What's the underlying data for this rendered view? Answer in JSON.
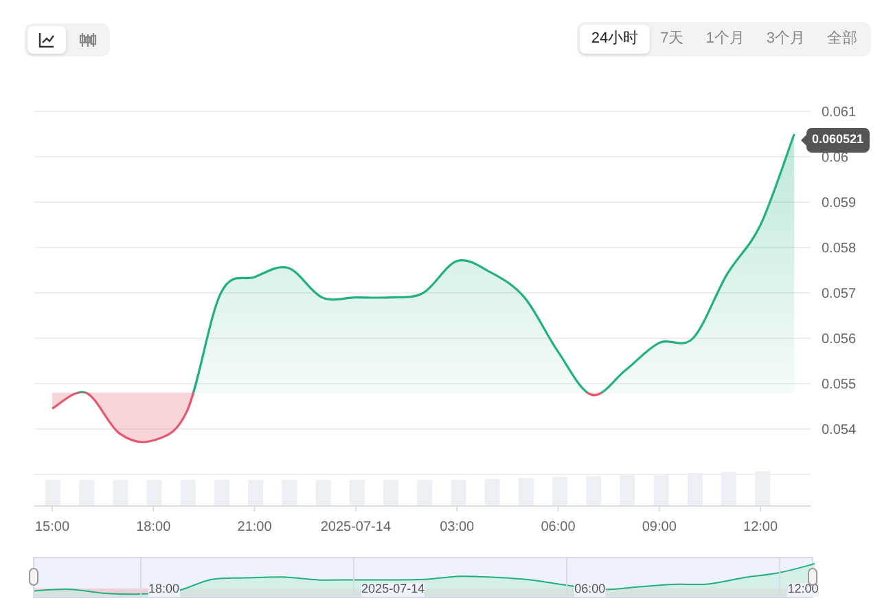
{
  "chart_type_toggle": [
    {
      "kind": "line",
      "selected": true
    },
    {
      "kind": "candles",
      "selected": false
    }
  ],
  "ranges": [
    {
      "label": "24小时",
      "selected": true
    },
    {
      "label": "7天",
      "selected": false
    },
    {
      "label": "1个月",
      "selected": false
    },
    {
      "label": "3个月",
      "selected": false
    },
    {
      "label": "全部",
      "selected": false
    }
  ],
  "price_chart": {
    "chart_data": {
      "type": "area",
      "categories": [
        "15:00",
        null,
        null,
        "18:00",
        null,
        null,
        "21:00",
        null,
        null,
        "2025-07-14",
        null,
        null,
        "03:00",
        null,
        null,
        "06:00",
        null,
        null,
        "09:00",
        null,
        null,
        "12:00",
        null
      ],
      "series": [
        {
          "color": "#22b07d",
          "values": [
            0.05445,
            0.0548,
            0.0539,
            0.05375,
            0.0544,
            0.057,
            0.05735,
            0.05755,
            0.0569,
            0.0569,
            0.0569,
            0.057,
            0.0577,
            0.05745,
            0.0569,
            0.0557,
            0.05475,
            0.0553,
            0.0559,
            0.056,
            0.0574,
            0.0585,
            0.0605
          ]
        }
      ],
      "yticks": [
        0.054,
        0.055,
        0.056,
        0.057,
        0.058,
        0.059,
        {
          "value": 0.06,
          "label": "0.06"
        },
        0.061
      ],
      "grid": true,
      "ylim": [
        0.053,
        0.061
      ]
    },
    "last_price": "0.060521"
  },
  "navigator": {
    "labels": [
      "18:00",
      "2025-07-14",
      "06:00",
      "12:00"
    ]
  }
}
